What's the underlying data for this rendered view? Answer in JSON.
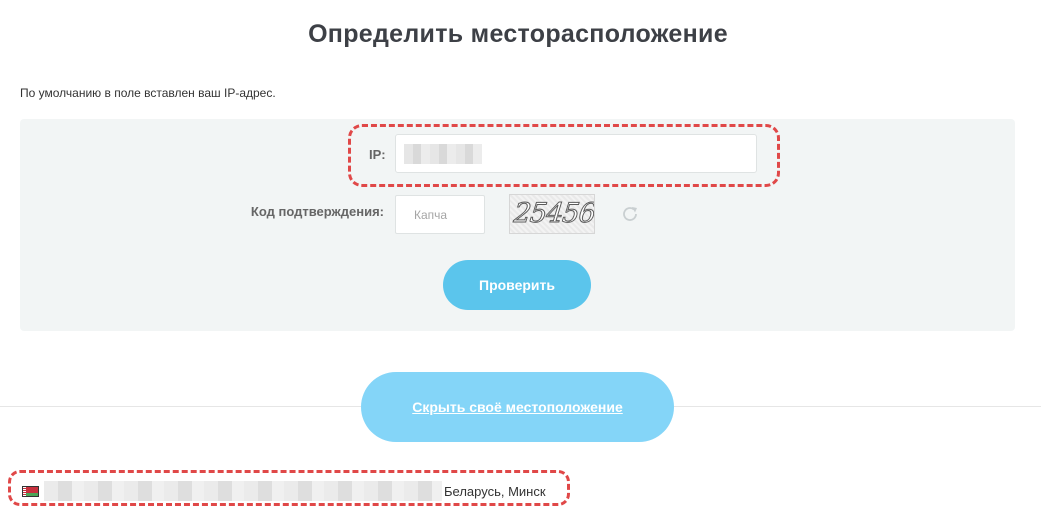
{
  "page": {
    "title": "Определить месторасположение",
    "hint": "По умолчанию в поле вставлен ваш IP-адрес."
  },
  "form": {
    "ip_label": "IP:",
    "ip_value": "",
    "captcha_label": "Код подтверждения:",
    "captcha_placeholder": "Капча",
    "captcha_image_text": "25456",
    "refresh_icon": "refresh-icon",
    "submit_label": "Проверить"
  },
  "hide_location": {
    "label": "Скрыть своё местоположение"
  },
  "location": {
    "flag_icon": "belarus-flag-icon",
    "text": "Беларусь, Минск"
  },
  "colors": {
    "primary_button": "#5bc5ec",
    "secondary_button": "#84d5f8",
    "highlight_outline": "#e04848",
    "panel_bg": "#f2f5f5",
    "title": "#3d4046"
  }
}
